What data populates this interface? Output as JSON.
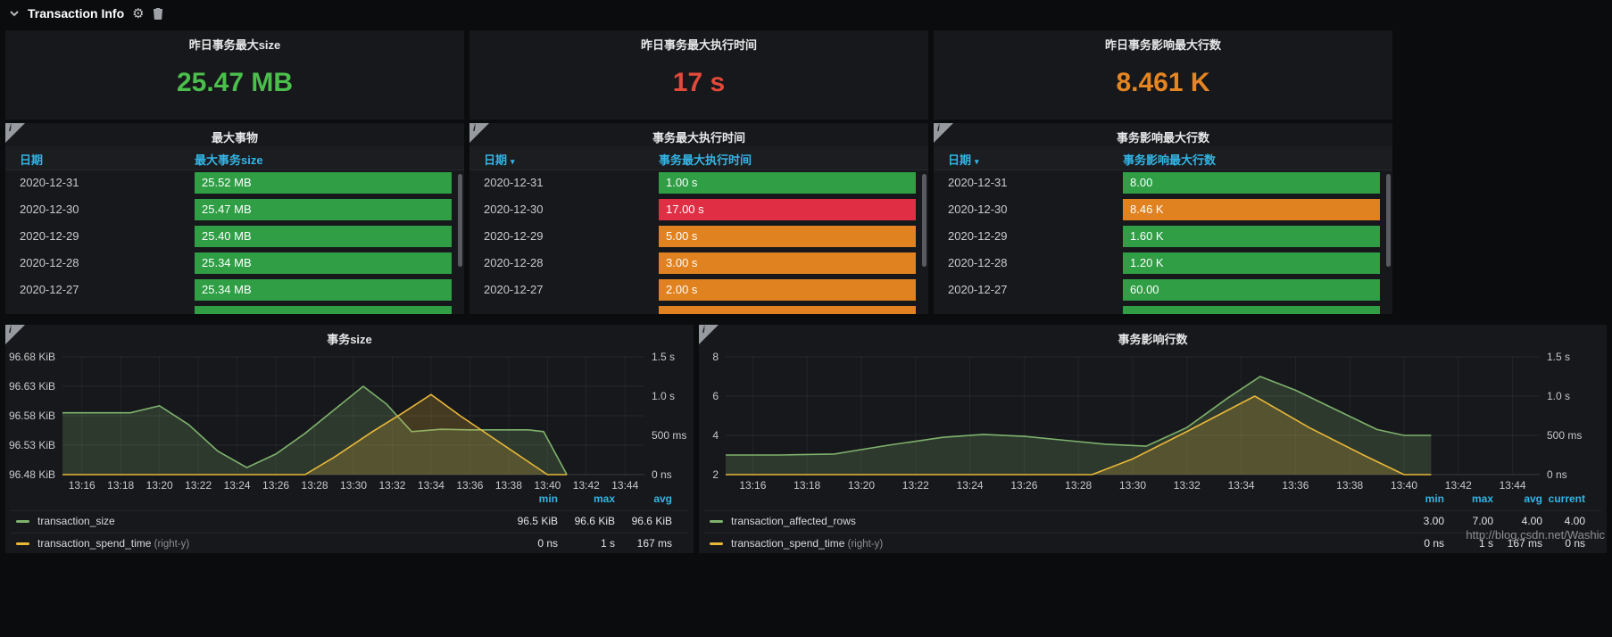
{
  "header": {
    "title": "Transaction Info"
  },
  "icons": {
    "info_glyph": "i",
    "caret_glyph": "▾"
  },
  "colors": {
    "green": "#2f9e45",
    "orange": "#e0821f",
    "red": "#e02f44",
    "blue": "#33b5e5",
    "graph_green": "#7eb26d",
    "graph_yellow": "#eab839"
  },
  "stats": [
    {
      "title": "昨日事务最大size",
      "value": "25.47 MB",
      "color": "#4bbf4c"
    },
    {
      "title": "昨日事务最大执行时间",
      "value": "17 s",
      "color": "#e2493b"
    },
    {
      "title": "昨日事务影响最大行数",
      "value": "8.461 K",
      "color": "#e58522"
    }
  ],
  "tables": [
    {
      "title": "最大事物",
      "columns": [
        "日期",
        "最大事务size"
      ],
      "sorted": false,
      "partial_color": "green",
      "rows": [
        {
          "date": "2020-12-31",
          "value": "25.52 MB",
          "color": "green"
        },
        {
          "date": "2020-12-30",
          "value": "25.47 MB",
          "color": "green"
        },
        {
          "date": "2020-12-29",
          "value": "25.40 MB",
          "color": "green"
        },
        {
          "date": "2020-12-28",
          "value": "25.34 MB",
          "color": "green"
        },
        {
          "date": "2020-12-27",
          "value": "25.34 MB",
          "color": "green"
        }
      ]
    },
    {
      "title": "事务最大执行时间",
      "columns": [
        "日期",
        "事务最大执行时间"
      ],
      "sorted": true,
      "partial_color": "orange",
      "rows": [
        {
          "date": "2020-12-31",
          "value": "1.00 s",
          "color": "green"
        },
        {
          "date": "2020-12-30",
          "value": "17.00 s",
          "color": "red"
        },
        {
          "date": "2020-12-29",
          "value": "5.00 s",
          "color": "orange"
        },
        {
          "date": "2020-12-28",
          "value": "3.00 s",
          "color": "orange"
        },
        {
          "date": "2020-12-27",
          "value": "2.00 s",
          "color": "orange"
        }
      ]
    },
    {
      "title": "事务影响最大行数",
      "columns": [
        "日期",
        "事务影响最大行数"
      ],
      "sorted": true,
      "partial_color": "green",
      "rows": [
        {
          "date": "2020-12-31",
          "value": "8.00",
          "color": "green"
        },
        {
          "date": "2020-12-30",
          "value": "8.46 K",
          "color": "orange"
        },
        {
          "date": "2020-12-29",
          "value": "1.60 K",
          "color": "green"
        },
        {
          "date": "2020-12-28",
          "value": "1.20 K",
          "color": "green"
        },
        {
          "date": "2020-12-27",
          "value": "60.00",
          "color": "green"
        }
      ]
    }
  ],
  "chart_data": [
    {
      "type": "area",
      "title": "事务size",
      "xlabel": "",
      "x_min": 795,
      "x_max": 825,
      "x_ticks": [
        "13:16",
        "13:18",
        "13:20",
        "13:22",
        "13:24",
        "13:26",
        "13:28",
        "13:30",
        "13:32",
        "13:34",
        "13:36",
        "13:38",
        "13:40",
        "13:42",
        "13:44"
      ],
      "left_axis": {
        "ticks": [
          "96.68 KiB",
          "96.63 KiB",
          "96.58 KiB",
          "96.53 KiB",
          "96.48 KiB"
        ],
        "min": 96.48,
        "max": 96.68
      },
      "right_axis": {
        "ticks": [
          "1.5 s",
          "1.0 s",
          "500 ms",
          "0 ns"
        ],
        "min": 0,
        "max": 1.5
      },
      "series": [
        {
          "name": "transaction_size",
          "axis": "left",
          "color_key": "graph_green",
          "points": [
            [
              795,
              96.585
            ],
            [
              797,
              96.585
            ],
            [
              798.5,
              96.585
            ],
            [
              800,
              96.597
            ],
            [
              801.5,
              96.565
            ],
            [
              803,
              96.52
            ],
            [
              804.5,
              96.492
            ],
            [
              806,
              96.515
            ],
            [
              807.5,
              96.55
            ],
            [
              809,
              96.59
            ],
            [
              810.5,
              96.63
            ],
            [
              811.7,
              96.6
            ],
            [
              813,
              96.553
            ],
            [
              814.5,
              96.557
            ],
            [
              816,
              96.556
            ],
            [
              817.5,
              96.556
            ],
            [
              819,
              96.556
            ],
            [
              819.8,
              96.553
            ],
            [
              821,
              96.48
            ]
          ]
        },
        {
          "name": "transaction_spend_time",
          "axis": "right",
          "color_key": "graph_yellow",
          "points": [
            [
              795,
              0
            ],
            [
              807.5,
              0
            ],
            [
              809,
              0.22
            ],
            [
              811,
              0.55
            ],
            [
              812.5,
              0.78
            ],
            [
              814,
              1.02
            ],
            [
              815.5,
              0.75
            ],
            [
              817,
              0.5
            ],
            [
              818.5,
              0.25
            ],
            [
              820,
              0
            ],
            [
              821,
              0
            ]
          ]
        }
      ],
      "legend": {
        "headers": [
          "min",
          "max",
          "avg"
        ],
        "rows": [
          {
            "name": "transaction_size",
            "suffix": "",
            "color_key": "graph_green",
            "values": [
              "96.5 KiB",
              "96.6 KiB",
              "96.6 KiB"
            ]
          },
          {
            "name": "transaction_spend_time",
            "suffix": "(right-y)",
            "color_key": "graph_yellow",
            "values": [
              "0 ns",
              "1 s",
              "167 ms"
            ]
          }
        ]
      }
    },
    {
      "type": "area",
      "title": "事务影响行数",
      "xlabel": "",
      "x_min": 795,
      "x_max": 825,
      "x_ticks": [
        "13:16",
        "13:18",
        "13:20",
        "13:22",
        "13:24",
        "13:26",
        "13:28",
        "13:30",
        "13:32",
        "13:34",
        "13:36",
        "13:38",
        "13:40",
        "13:42",
        "13:44"
      ],
      "left_axis": {
        "ticks": [
          "8",
          "6",
          "4",
          "2"
        ],
        "min": 2,
        "max": 8
      },
      "right_axis": {
        "ticks": [
          "1.5 s",
          "1.0 s",
          "500 ms",
          "0 ns"
        ],
        "min": 0,
        "max": 1.5
      },
      "series": [
        {
          "name": "transaction_affected_rows",
          "axis": "left",
          "color_key": "graph_green",
          "points": [
            [
              795,
              3
            ],
            [
              797,
              3
            ],
            [
              799,
              3.05
            ],
            [
              801,
              3.5
            ],
            [
              803,
              3.9
            ],
            [
              804.5,
              4.05
            ],
            [
              806,
              3.95
            ],
            [
              807.5,
              3.75
            ],
            [
              809,
              3.55
            ],
            [
              810.5,
              3.45
            ],
            [
              812,
              4.4
            ],
            [
              813.5,
              5.9
            ],
            [
              814.7,
              7
            ],
            [
              816,
              6.3
            ],
            [
              817.5,
              5.3
            ],
            [
              819,
              4.3
            ],
            [
              820,
              4
            ],
            [
              821,
              4
            ]
          ]
        },
        {
          "name": "transaction_spend_time",
          "axis": "right",
          "color_key": "graph_yellow",
          "points": [
            [
              795,
              0
            ],
            [
              808.5,
              0
            ],
            [
              810,
              0.2
            ],
            [
              812,
              0.55
            ],
            [
              814.5,
              1.0
            ],
            [
              816.5,
              0.6
            ],
            [
              818.5,
              0.25
            ],
            [
              820,
              0
            ],
            [
              821,
              0
            ]
          ]
        }
      ],
      "legend": {
        "headers": [
          "min",
          "max",
          "avg",
          "current"
        ],
        "rows": [
          {
            "name": "transaction_affected_rows",
            "suffix": "",
            "color_key": "graph_green",
            "values": [
              "3.00",
              "7.00",
              "4.00",
              "4.00"
            ]
          },
          {
            "name": "transaction_spend_time",
            "suffix": "(right-y)",
            "color_key": "graph_yellow",
            "values": [
              "0 ns",
              "1 s",
              "167 ms",
              "0 ns"
            ]
          }
        ]
      }
    }
  ],
  "watermark": "http://blog.csdn.net/Washic"
}
